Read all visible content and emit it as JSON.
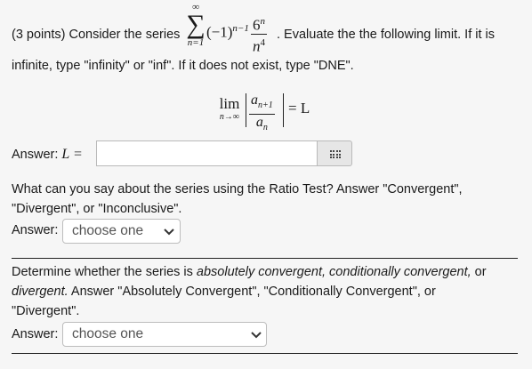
{
  "question": {
    "part1": {
      "prefix": "(3 points) Consider the series",
      "sum_upper": "∞",
      "sum_lower": "n=1",
      "sign_base": "(−1)",
      "sign_exp": "n−1",
      "frac_num": "6",
      "frac_num_exp": "n",
      "frac_den": "n",
      "frac_den_exp": "4",
      "suffix": ". Evaluate the the following limit. If it is",
      "line2": "infinite, type \"infinity\" or \"inf\". If it does not exist, type \"DNE\".",
      "lim_word": "lim",
      "lim_sub": "n→∞",
      "ratio_num": "a",
      "ratio_num_sub": "n+1",
      "ratio_den": "a",
      "ratio_den_sub": "n",
      "equals_L": "= L",
      "answer_label": "Answer:",
      "answer_var": "L =",
      "answer_value": ""
    },
    "part2": {
      "line1": "What can you say about the series using the Ratio Test? Answer \"Convergent\",",
      "line2": "\"Divergent\", or \"Inconclusive\".",
      "answer_label": "Answer:",
      "select_value": "choose one"
    },
    "part3": {
      "line1_a": "Determine whether the series is ",
      "line1_b": "absolutely convergent, conditionally convergent,",
      "line1_c": " or",
      "line2_a": "divergent.",
      "line2_b": " Answer \"Absolutely Convergent\", \"Conditionally Convergent\", or",
      "line3": "\"Divergent\".",
      "answer_label": "Answer:",
      "select_value": "choose one"
    }
  }
}
